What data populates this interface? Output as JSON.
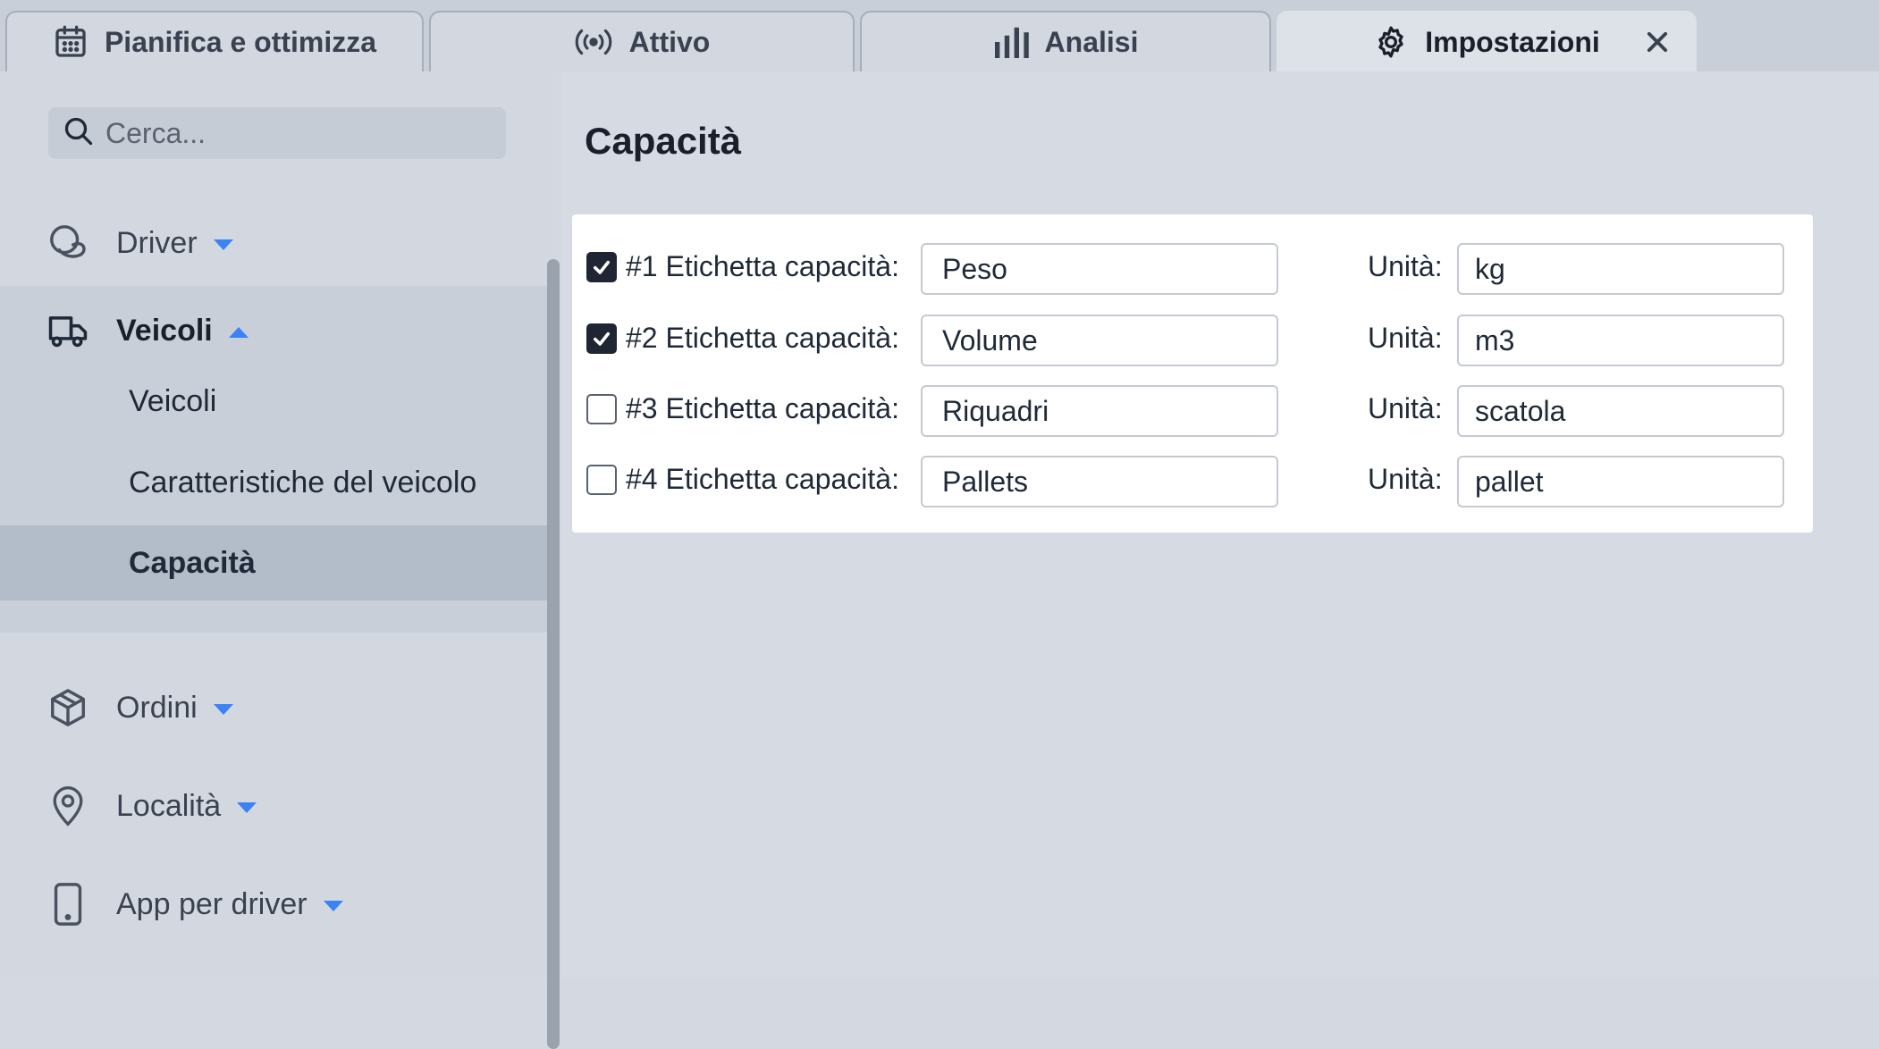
{
  "tabs": [
    {
      "label": "Pianifica e ottimizza",
      "icon": "calendar-icon"
    },
    {
      "label": "Attivo",
      "icon": "broadcast-icon"
    },
    {
      "label": "Analisi",
      "icon": "bar-chart-icon"
    },
    {
      "label": "Impostazioni",
      "icon": "gear-icon",
      "active": true
    }
  ],
  "sidebar": {
    "search_placeholder": "Cerca...",
    "items": [
      {
        "label": "Driver",
        "icon": "driver-icon",
        "expanded": false
      },
      {
        "label": "Veicoli",
        "icon": "truck-icon",
        "expanded": true
      },
      {
        "label": "Ordini",
        "icon": "package-icon",
        "expanded": false
      },
      {
        "label": "Località",
        "icon": "map-pin-icon",
        "expanded": false
      },
      {
        "label": "App per driver",
        "icon": "phone-icon",
        "expanded": false
      }
    ],
    "veicoli_children": [
      {
        "label": "Veicoli"
      },
      {
        "label": "Caratteristiche del veicolo"
      },
      {
        "label": "Capacità",
        "selected": true
      }
    ]
  },
  "main": {
    "title": "Capacità",
    "unit_label": "Unità:",
    "capacities": [
      {
        "label": "#1 Etichetta capacità:",
        "checked": true,
        "value": "Peso",
        "unit": "kg"
      },
      {
        "label": "#2 Etichetta capacità:",
        "checked": true,
        "value": "Volume",
        "unit": "m3"
      },
      {
        "label": "#3 Etichetta capacità:",
        "checked": false,
        "value": "Riquadri",
        "unit": "scatola"
      },
      {
        "label": "#4 Etichetta capacità:",
        "checked": false,
        "value": "Pallets",
        "unit": "pallet"
      }
    ]
  },
  "colors": {
    "accent": "#3b82f6",
    "checkbox_checked": "#1f2533"
  }
}
